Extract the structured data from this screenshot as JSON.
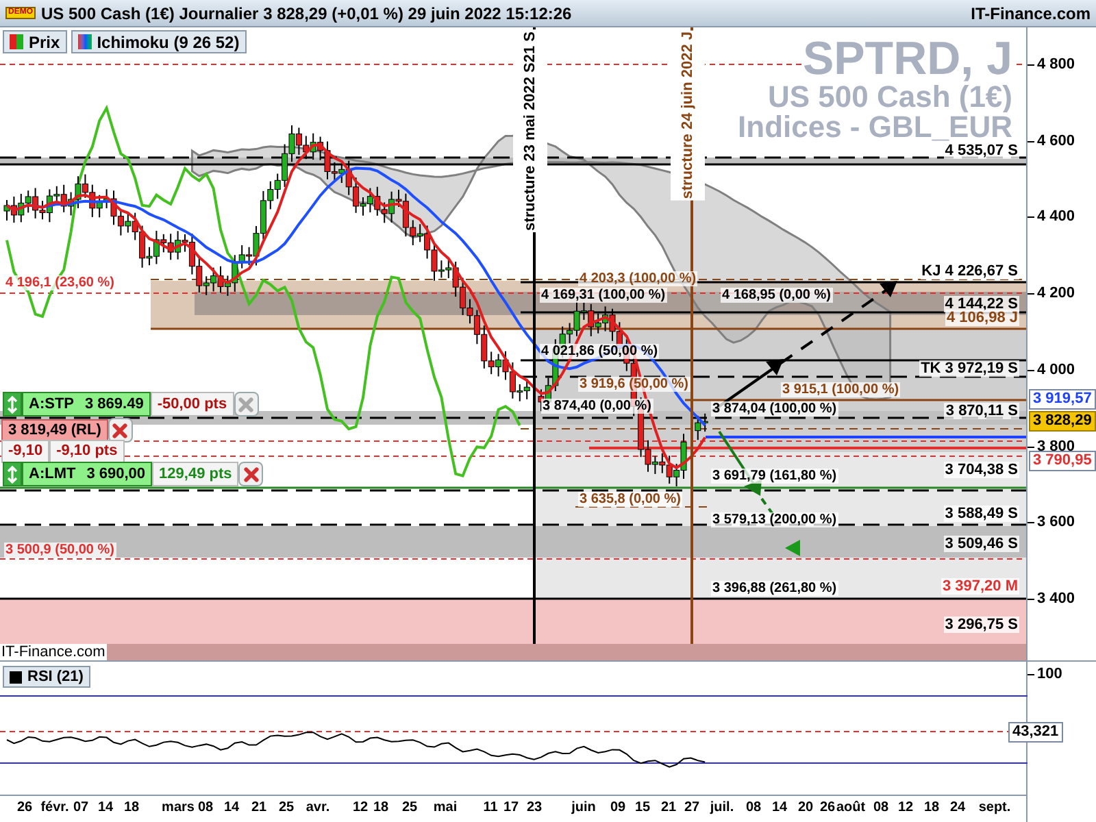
{
  "header": {
    "badge": "DEMO",
    "title": "US 500 Cash (1€) Journalier 3 828,29 (+0,01 %) 29 juin 2022 15:12:26",
    "site": "IT-Finance.com"
  },
  "legend": [
    {
      "label": "Prix",
      "kind": "price"
    },
    {
      "label": "Ichimoku (9 26 52)",
      "kind": "ichimoku"
    }
  ],
  "chart_caption": {
    "symbol": "SPTRD, J",
    "instrument": "US 500 Cash (1€)",
    "market": "Indices - GBL_EUR"
  },
  "structure_lines": [
    {
      "label": "structure 23 mai 2022 S21 S",
      "color": "#000000"
    },
    {
      "label": "structure 24 juin 2022 J",
      "color": "#8b4513"
    }
  ],
  "orders": [
    {
      "kind": "stop",
      "label": "A:STP",
      "price": "3 869.49",
      "distance": "-50,00 pts",
      "close_disabled": true
    },
    {
      "kind": "trail",
      "price": "3 819,49",
      "tag": "(RL)",
      "close_disabled": false
    },
    {
      "kind": "offset",
      "price": "-9,10",
      "distance": "-9,10 pts"
    },
    {
      "kind": "limit",
      "label": "A:LMT",
      "price": "3 690,00",
      "distance": "129,49 pts",
      "close_disabled": false
    }
  ],
  "level_labels": [
    {
      "text": "4 535,07 S",
      "color": "#000000"
    },
    {
      "text": "KJ 4 226,67 S",
      "color": "#000000"
    },
    {
      "text": "4 144,22 S",
      "color": "#000000"
    },
    {
      "text": "4 106,98 J",
      "color": "#8b4513"
    },
    {
      "text": "TK 3 972,19 S",
      "color": "#000000"
    },
    {
      "text": "3 870,11 S",
      "color": "#000000"
    },
    {
      "text": "3 704,38 S",
      "color": "#000000"
    },
    {
      "text": "3 588,49 S",
      "color": "#000000"
    },
    {
      "text": "3 509,46 S",
      "color": "#000000"
    },
    {
      "text": "3 397,20 M",
      "color": "#e03030"
    },
    {
      "text": "3 296,75 S",
      "color": "#000000"
    }
  ],
  "fib_labels": [
    {
      "text": "4 196,1 (23,60 %)",
      "color": "#e03030"
    },
    {
      "text": "4 203,3 (100,00 %)",
      "color": "#8b4513"
    },
    {
      "text": "4 169,31 (100,00 %)",
      "color": "#000000"
    },
    {
      "text": "4 168,95 (0,00 %)",
      "color": "#000000"
    },
    {
      "text": "4 021,86 (50,00 %)",
      "color": "#000000"
    },
    {
      "text": "3 919,6 (50,00 %)",
      "color": "#8b4513"
    },
    {
      "text": "3 915,1 (100,00 %)",
      "color": "#8b4513"
    },
    {
      "text": "3 874,40 (0,00 %)",
      "color": "#000000"
    },
    {
      "text": "3 874,04 (100,00 %)",
      "color": "#000000"
    },
    {
      "text": "3 691,79 (161,80 %)",
      "color": "#000000"
    },
    {
      "text": "3 635,8 (0,00 %)",
      "color": "#8b4513"
    },
    {
      "text": "3 579,13 (200,00 %)",
      "color": "#000000"
    },
    {
      "text": "3 500,9 (50,00 %)",
      "color": "#e03030"
    },
    {
      "text": "3 396,88 (261,80 %)",
      "color": "#000000"
    }
  ],
  "price_axis": [
    "4 800",
    "4 600",
    "4 400",
    "4 200",
    "4 000",
    "3 800",
    "3 600",
    "3 400"
  ],
  "price_tags": [
    {
      "text": "3 919,57",
      "kind": "kijun"
    },
    {
      "text": "3 828,29",
      "kind": "last"
    },
    {
      "text": "3 790,95",
      "kind": "tenkan"
    }
  ],
  "footer_site": "IT-Finance.com",
  "rsi": {
    "label": "RSI (21)",
    "ticks": [
      "100"
    ],
    "value": "43,321"
  },
  "date_axis": [
    "26",
    "févr.",
    "07",
    "14",
    "18",
    "mars",
    "08",
    "14",
    "21",
    "25",
    "avr.",
    "12",
    "18",
    "25",
    "mai",
    "11",
    "17",
    "23",
    "juin",
    "09",
    "15",
    "21",
    "27",
    "juil.",
    "08",
    "14",
    "20",
    "26",
    "août",
    "08",
    "12",
    "18",
    "24",
    "sept."
  ]
}
